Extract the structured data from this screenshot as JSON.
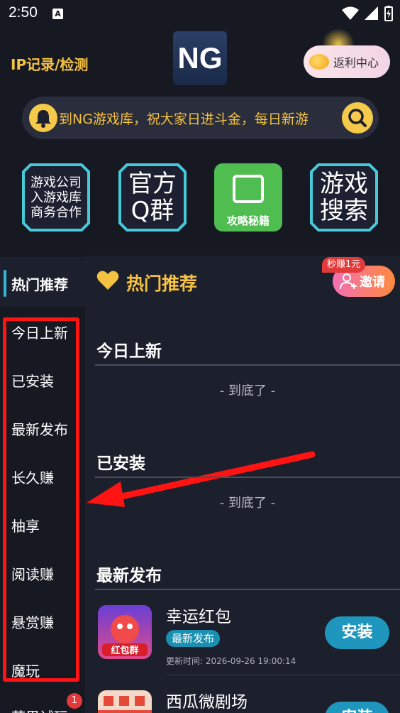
{
  "status": {
    "time": "2:50"
  },
  "header": {
    "ip_link": "IP记录/检测",
    "logo": "NG",
    "rebate": "返利中心"
  },
  "notice": {
    "text": "到NG游戏库，祝大家日进斗金，每日新游"
  },
  "tiles": {
    "company": "游戏公司入游戏库商务合作",
    "qq_group": "官方Q群",
    "guide": "攻略秘籍",
    "search": "游戏搜索"
  },
  "sidebar": {
    "active": "热门推荐",
    "items": [
      "今日上新",
      "已安装",
      "最新发布",
      "长久赚",
      "柚享",
      "阅读赚",
      "悬赏赚",
      "魔玩",
      "苹果试玩"
    ],
    "badge": "1"
  },
  "main": {
    "title": "热门推荐",
    "invite": "邀请",
    "invite_tag": "秒赚1元",
    "sections": [
      {
        "title": "今日上新",
        "end": "- 到底了 -"
      },
      {
        "title": "已安装",
        "end": "- 到底了 -"
      },
      {
        "title": "最新发布"
      }
    ],
    "games": [
      {
        "name": "幸运红包",
        "tag": "最新发布",
        "time": "更新时间: 2026-09-26 19:00:14",
        "button": "安装",
        "icon_text": "红包群"
      },
      {
        "name": "西瓜微剧场",
        "button": "安装"
      }
    ]
  },
  "colors": {
    "accent": "#f5c242",
    "install": "#1e96bd",
    "highlight": "#ff1313"
  }
}
